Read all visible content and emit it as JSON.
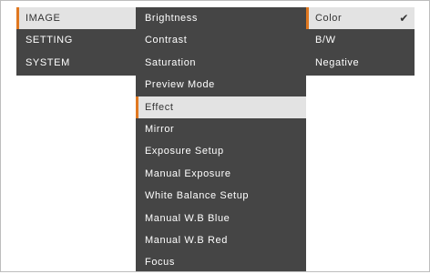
{
  "main_menu": {
    "items": [
      {
        "label": "IMAGE",
        "selected": true
      },
      {
        "label": "SETTING",
        "selected": false
      },
      {
        "label": "SYSTEM",
        "selected": false
      }
    ]
  },
  "image_menu": {
    "items": [
      {
        "label": "Brightness",
        "selected": false
      },
      {
        "label": "Contrast",
        "selected": false
      },
      {
        "label": "Saturation",
        "selected": false
      },
      {
        "label": "Preview Mode",
        "selected": false
      },
      {
        "label": "Effect",
        "selected": true
      },
      {
        "label": "Mirror",
        "selected": false
      },
      {
        "label": "Exposure Setup",
        "selected": false
      },
      {
        "label": "Manual Exposure",
        "selected": false
      },
      {
        "label": "White Balance Setup",
        "selected": false
      },
      {
        "label": "Manual W.B Blue",
        "selected": false
      },
      {
        "label": "Manual W.B Red",
        "selected": false
      },
      {
        "label": "Focus",
        "selected": false
      }
    ]
  },
  "effect_menu": {
    "items": [
      {
        "label": "Color",
        "selected": true,
        "checked": true
      },
      {
        "label": "B/W",
        "selected": false,
        "checked": false
      },
      {
        "label": "Negative",
        "selected": false,
        "checked": false
      }
    ],
    "check_icon": "check-icon"
  },
  "colors": {
    "menu_background": "#454545",
    "selected_background": "#e3e3e3",
    "accent": "#e07820",
    "text_light": "#ffffff",
    "text_dark": "#333333"
  }
}
